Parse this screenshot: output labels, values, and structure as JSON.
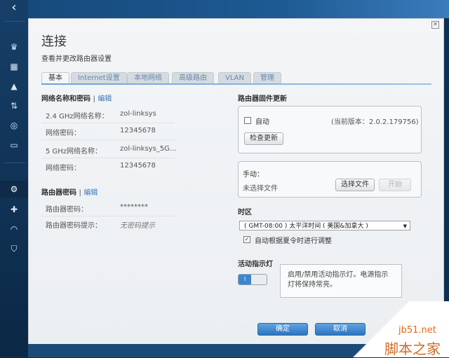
{
  "window": {
    "title": "连接",
    "subtitle": "查看并更改路由器设置",
    "close_icon": "✕"
  },
  "tabs": [
    {
      "label": "基本",
      "active": true
    },
    {
      "label": "Internet设置",
      "active": false
    },
    {
      "label": "本地网络",
      "active": false
    },
    {
      "label": "高级路由",
      "active": false
    },
    {
      "label": "VLAN",
      "active": false
    },
    {
      "label": "管理",
      "active": false
    }
  ],
  "wireless": {
    "header": "网络名称和密码",
    "separator": "|",
    "edit": "编辑",
    "rows": [
      {
        "label": "2.4 GHz网络名称：",
        "value": "zol-linksys"
      },
      {
        "label": "网络密码：",
        "value": "12345678"
      },
      {
        "label": "5 GHz网络名称：",
        "value": "zol-linksys_5G..."
      },
      {
        "label": "网络密码：",
        "value": "12345678"
      }
    ]
  },
  "router_password": {
    "header": "路由器密码",
    "separator": "|",
    "edit": "编辑",
    "rows": [
      {
        "label": "路由器密码：",
        "value": "********"
      },
      {
        "label": "路由器密码提示：",
        "value": "无密码提示"
      }
    ]
  },
  "firmware": {
    "header": "路由器固件更新",
    "auto_label": "自动",
    "current_version": "(当前版本：2.0.2.179756)",
    "check_button": "检查更新",
    "manual_label": "手动：",
    "no_file": "未选择文件",
    "choose_button": "选择文件",
    "start_button": "开始"
  },
  "timezone": {
    "header": "时区",
    "selected": "( GMT-08:00 ) 太平洋时间 ( 美国&加拿大 )",
    "dst_checked": true,
    "dst_label": "自动根据夏令时进行调整"
  },
  "activity_led": {
    "header": "活动指示灯",
    "toggle_label": "I",
    "tip": "启用/禁用活动指示灯。电源指示灯将保持常亮。"
  },
  "footer": {
    "ok": "确定",
    "cancel": "取消"
  },
  "watermark": {
    "site": "jb51.net",
    "name": "脚本之家"
  },
  "colors": {
    "accent": "#3a86cf",
    "link": "#3b77b6",
    "sidebar": "#163f68"
  }
}
